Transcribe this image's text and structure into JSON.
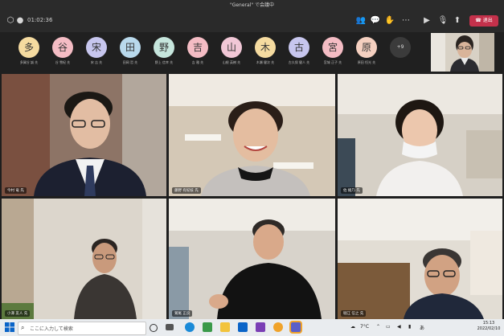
{
  "window": {
    "title": "\"General\" で会議中"
  },
  "toolbar": {
    "timer": "01:02:36",
    "leave_label": "退出"
  },
  "participants": [
    {
      "initial": "多",
      "name": "多賀谷 誠 先",
      "color": "#f5dba0"
    },
    {
      "initial": "谷",
      "name": "谷 雪紀 先",
      "color": "#f4bcc4"
    },
    {
      "initial": "宋",
      "name": "宋 吉 先",
      "color": "#c7c6ee"
    },
    {
      "initial": "田",
      "name": "田岡 哲 先",
      "color": "#b9d9ec"
    },
    {
      "initial": "野",
      "name": "野上 信幸 先",
      "color": "#c6e6dd"
    },
    {
      "initial": "吉",
      "name": "吉 雅 先",
      "color": "#f4bcc4"
    },
    {
      "initial": "山",
      "name": "山根 英樹 先",
      "color": "#f1c7d6"
    },
    {
      "initial": "木",
      "name": "木瀬 健次 先",
      "color": "#f5dba0"
    },
    {
      "initial": "古",
      "name": "古久保 健人 先",
      "color": "#c7c6ee"
    },
    {
      "initial": "宮",
      "name": "宮城 正子 先",
      "color": "#f4bcc4"
    },
    {
      "initial": "原",
      "name": "原田 恒光 先",
      "color": "#f5d0c0"
    }
  ],
  "more_count": "+9",
  "tiles": [
    {
      "name": "今村 竜 先"
    },
    {
      "name": "藤野 有紀枝 先"
    },
    {
      "name": "佐 綾乃 先"
    },
    {
      "name": "小澤 友人 先"
    },
    {
      "name": "鷲尾 正良"
    },
    {
      "name": "堀江 信之 先"
    }
  ],
  "taskbar": {
    "search_placeholder": "ここに入力して検索",
    "weather": "7°C",
    "time": "15:13",
    "date": "2022/02/10"
  },
  "icons": [
    "shield-icon",
    "people-icon",
    "chat-icon",
    "raise-hand-icon",
    "video-icon",
    "mic-icon",
    "share-icon",
    "phone-icon",
    "windows-icon",
    "search-icon"
  ]
}
